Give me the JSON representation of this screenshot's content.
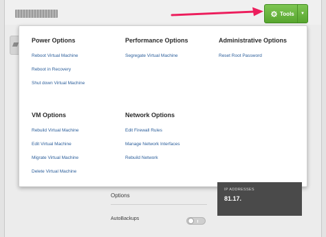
{
  "toolbar": {
    "tools_label": "Tools",
    "button_color": "#6ab63f"
  },
  "annotation": {
    "arrow_color": "#ec1d5c"
  },
  "menu": {
    "power": {
      "title": "Power Options",
      "items": [
        "Reboot Virtual Machine",
        "Reboot in Recovery",
        "Shut down Virtual Machine"
      ]
    },
    "performance": {
      "title": "Performance Options",
      "items": [
        "Segregate Virtual Machine"
      ]
    },
    "administrative": {
      "title": "Administrative Options",
      "items": [
        "Reset Root Password"
      ]
    },
    "vm": {
      "title": "VM Options",
      "items": [
        "Rebuild Virtual Machine",
        "Edit Virtual Machine",
        "Migrate Virtual Machine",
        "Delete Virtual Machine"
      ]
    },
    "network": {
      "title": "Network Options",
      "items": [
        "Edit Firewall Rules",
        "Manage Network Interfaces",
        "Rebuild Network"
      ]
    }
  },
  "background": {
    "options_label": "Options",
    "autobackups_label": "AutoBackups",
    "autobackups_enabled": false,
    "ip_title": "IP ADDRESSES",
    "ip_value": "81.17."
  },
  "icons": {
    "tools": "gear-icon",
    "caret": "caret-down-icon"
  }
}
